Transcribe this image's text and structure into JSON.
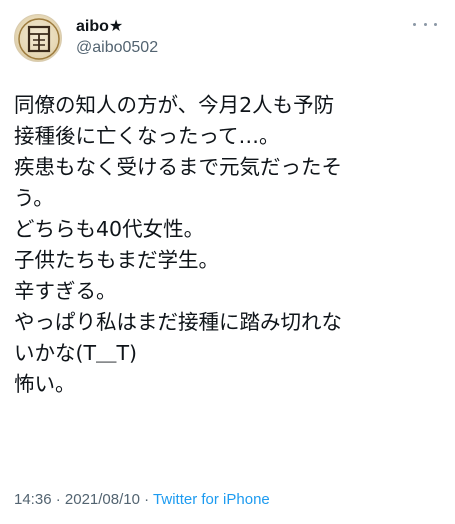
{
  "user": {
    "display_name": "aibo★",
    "handle": "@aibo0502",
    "avatar_glyph": "閃"
  },
  "tweet": {
    "lines": [
      "同僚の知人の方が、今月2人も予防",
      "接種後に亡くなったって…。",
      "疾患もなく受けるまで元気だったそ",
      "う。",
      "どちらも40代女性。",
      "子供たちもまだ学生。",
      "辛すぎる。",
      "やっぱり私はまだ接種に踏み切れな",
      "いかな(T＿T)",
      "怖い。"
    ]
  },
  "meta": {
    "time": "14:36",
    "sep1": " · ",
    "date": "2021/08/10",
    "sep2": " · ",
    "source": "Twitter for iPhone"
  },
  "icons": {
    "more": "more-horizontal-icon"
  },
  "colors": {
    "text": "#0f1419",
    "secondary": "#536471",
    "link": "#1d9bf0"
  }
}
